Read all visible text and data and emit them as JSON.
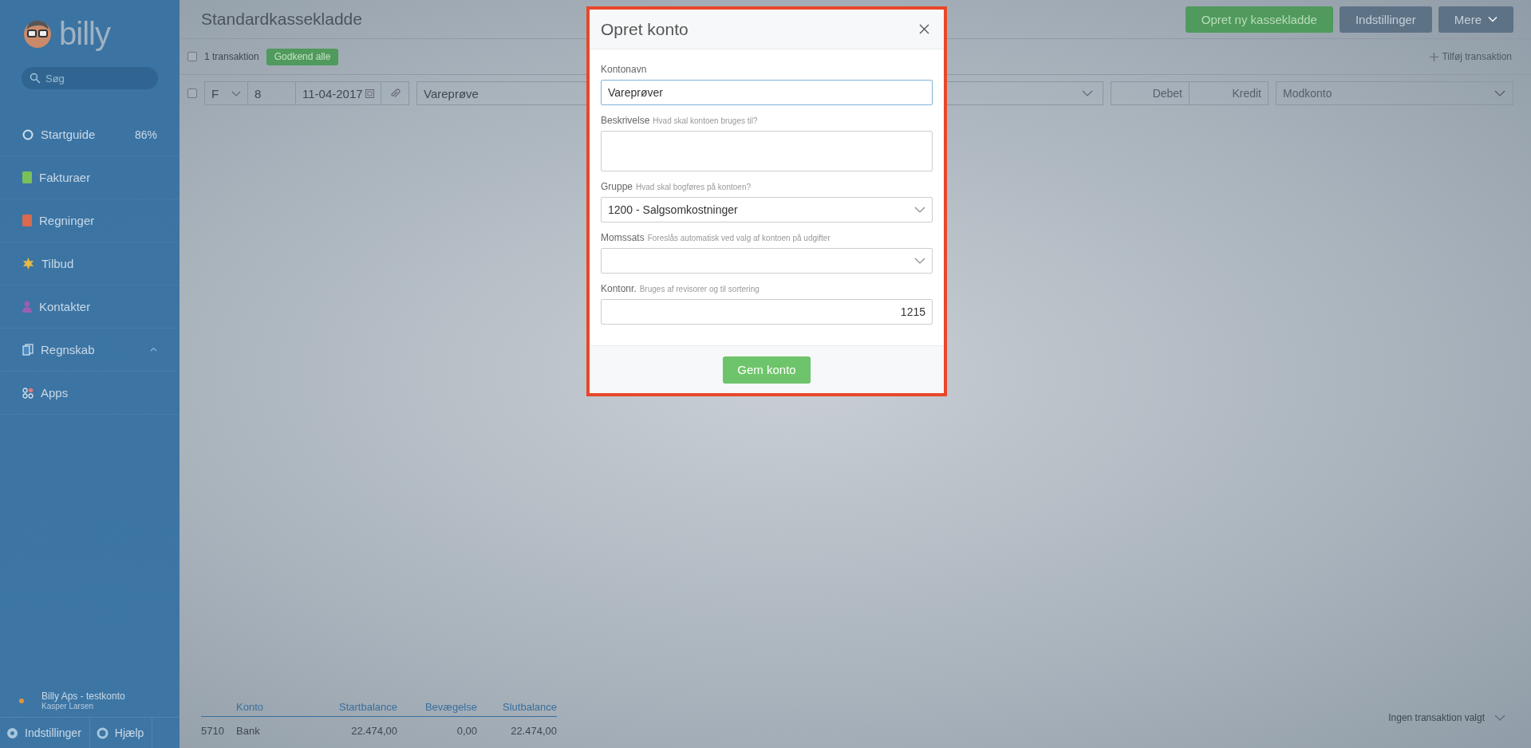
{
  "sidebar": {
    "logo": "billy",
    "search": {
      "placeholder": "Søg"
    },
    "items": [
      {
        "label": "Startguide",
        "badge": "86%",
        "kind": "ring",
        "expandable": false
      },
      {
        "label": "Fakturaer",
        "kind": "doc",
        "color": "#7bbf5a",
        "expandable": false
      },
      {
        "label": "Regninger",
        "kind": "doc",
        "color": "#d9694f",
        "expandable": false
      },
      {
        "label": "Tilbud",
        "kind": "star",
        "color": "#e5b942",
        "expandable": false
      },
      {
        "label": "Kontakter",
        "kind": "person",
        "color": "#9a5fb0",
        "expandable": false
      },
      {
        "label": "Regnskab",
        "kind": "pages",
        "expandable": true
      },
      {
        "label": "Apps",
        "kind": "apps",
        "expandable": false
      }
    ],
    "account": {
      "name": "Billy Aps - testkonto",
      "user": "Kasper Larsen"
    },
    "footer": [
      {
        "label": "Indstillinger",
        "kind": "gear"
      },
      {
        "label": "Hjælp",
        "kind": "lifebuoy"
      }
    ]
  },
  "header": {
    "title": "Standardkassekladde",
    "buttons": [
      {
        "label": "Opret ny kassekladde",
        "kind": "primary"
      },
      {
        "label": "Indstillinger",
        "kind": "secondary"
      },
      {
        "label": "Mere",
        "kind": "menu"
      }
    ]
  },
  "toolbar": {
    "select_all": {
      "checked": false
    },
    "count": "1 transaktion",
    "approve": "Godkend alle",
    "add": "Tilføj transaktion"
  },
  "row": {
    "checked": false,
    "type": "F",
    "number": "8",
    "date": "11-04-2017",
    "description": "Vareprøve",
    "debit_placeholder": "Debet",
    "credit_placeholder": "Kredit",
    "contra_placeholder": "Modkonto"
  },
  "balance": {
    "columns": [
      "",
      "Konto",
      "Startbalance",
      "Bevægelse",
      "Slutbalance"
    ],
    "rows": [
      [
        "5710",
        "Bank",
        "22.474,00",
        "0,00",
        "22.474,00"
      ]
    ]
  },
  "selection": "Ingen transaktion valgt",
  "modal": {
    "title": "Opret konto",
    "fields": [
      {
        "label": "Kontonavn",
        "kind": "text",
        "value": "Vareprøver",
        "focused": true
      },
      {
        "label": "Beskrivelse",
        "hint": "Hvad skal kontoen bruges til?",
        "kind": "textarea",
        "focused": false
      },
      {
        "label": "Gruppe",
        "hint": "Hvad skal bogføres på kontoen?",
        "kind": "select",
        "value": "1200 - Salgsomkostninger",
        "focused": false
      },
      {
        "label": "Momssats",
        "hint": "Foreslås automatisk ved valg af kontoen på udgifter",
        "kind": "select",
        "focused": false
      },
      {
        "label": "Kontonr.",
        "hint": "Bruges af revisorer og til sortering",
        "kind": "number",
        "value": "1215",
        "focused": false
      }
    ],
    "submit": "Gem konto"
  }
}
